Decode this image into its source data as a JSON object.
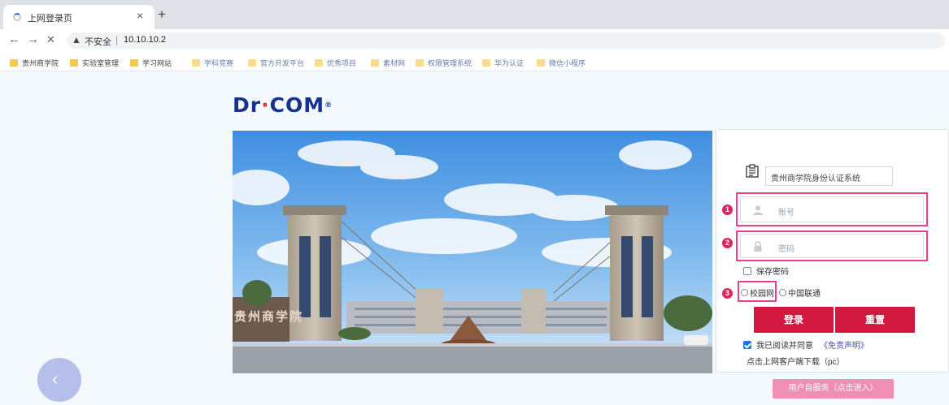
{
  "browser": {
    "tab": {
      "title": "上网登录页"
    },
    "new_tab_symbol": "+",
    "tab_close_symbol": "×",
    "nav": {
      "back": "←",
      "forward": "→",
      "stop": "✕"
    },
    "address": {
      "security_label": "不安全",
      "separator": "|",
      "url": "10.10.10.2"
    },
    "bookmarks": [
      {
        "label": "贵州商学院"
      },
      {
        "label": "实验室管理"
      },
      {
        "label": "学习网站"
      },
      {
        "label": "学科竞赛"
      },
      {
        "label": "官方开发平台"
      },
      {
        "label": "优秀项目"
      },
      {
        "label": "素材网"
      },
      {
        "label": "权限管理系统"
      },
      {
        "label": "华为认证"
      },
      {
        "label": "微信小程序"
      }
    ]
  },
  "page": {
    "logo": {
      "text_a": "Dr",
      "text_dot": "·",
      "text_b": "COM",
      "mark": "®"
    },
    "photo": {
      "caption": "贵州商学院"
    },
    "login": {
      "system_name": "贵州商学院身份认证系统",
      "account_placeholder": "账号",
      "password_placeholder": "密码",
      "remember_password": "保存密码",
      "network_options": [
        "校园网",
        "中国联通"
      ],
      "login_button": "登录",
      "reset_button": "重置",
      "agree_text": "我已阅读并同意",
      "disclaimer_link": "《免责声明》",
      "download_text": "点击上网客户端下载（pc）",
      "markers": [
        "1",
        "2",
        "3"
      ]
    },
    "self_service_button": "用户自服务（点击进入）",
    "back_arrow": "‹"
  },
  "colors": {
    "primary_red": "#d3183f",
    "highlight_pink": "#ea3f8c",
    "self_service_pink": "#f08fb4",
    "back_button": "#b6bfe9",
    "logo_blue": "#16328c"
  }
}
